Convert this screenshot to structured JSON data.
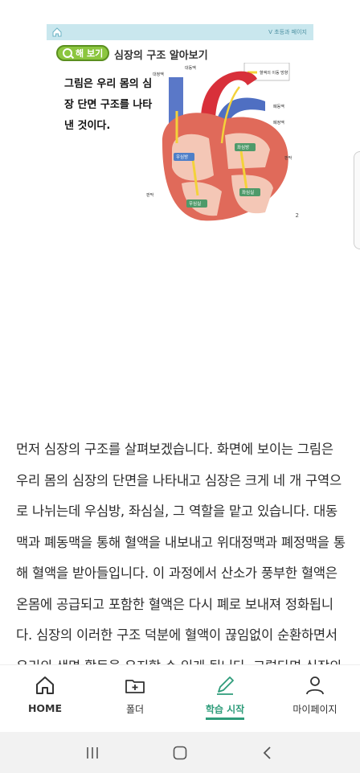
{
  "slide": {
    "top_label": "V 초등과 페이지",
    "tag_label": "해 보기",
    "title": "심장의 구조 알아보기",
    "description": "그림은 우리 몸의 심장 단면 구조를 나타낸 것이다.",
    "legend": "혈액의 이동 방향",
    "labels": {
      "vena_cava": "대정맥",
      "aorta": "대동맥",
      "pulmonary_artery": "폐동맥",
      "pulmonary_vein": "폐정맥",
      "valve": "판막",
      "right_atrium": "우심방",
      "left_atrium": "좌심방",
      "right_ventricle": "우심실",
      "left_ventricle": "좌심실",
      "valve2": "판막"
    },
    "page_number": "2"
  },
  "article": {
    "text": "먼저 심장의 구조를 살펴보겠습니다. 화면에 보이는 그림은 우리 몸의 심장의 단면을 나타내고 심장은 크게 네 개 구역으로 나뉘는데 우심방, 좌심실, 그 역할을 맡고 있습니다. 대동맥과 폐동맥을 통해 혈액을 내보내고 위대정맥과 폐정맥을 통해 혈액을 받아들입니다. 이 과정에서 산소가 풍부한 혈액은 온몸에 공급되고 포함한 혈액은 다시 폐로 보내져 정화됩니다. 심장의 이러한 구조 덕분에 혈액이 끊임없이 순환하면서 우리의 생명 활동을 유지할 수 있게 됩니다. 그렇다면 심장의 구조"
  },
  "tabs": [
    {
      "label": "HOME",
      "icon": "home-icon"
    },
    {
      "label": "폴더",
      "icon": "folder-add-icon"
    },
    {
      "label": "학습 시작",
      "icon": "pen-icon"
    },
    {
      "label": "마이페이지",
      "icon": "person-icon"
    }
  ],
  "colors": {
    "accent": "#2e9c7a",
    "pill": "#8cc63f"
  }
}
